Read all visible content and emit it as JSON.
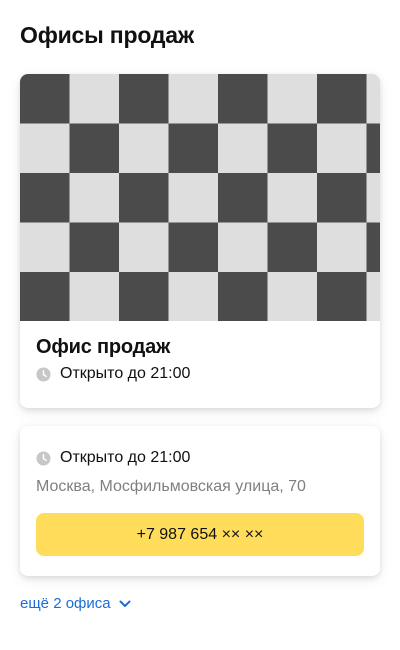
{
  "page": {
    "title": "Офисы продаж"
  },
  "office_card": {
    "image_icon": "checkerboard-placeholder-image",
    "name": "Офис продаж",
    "hours_icon": "clock-icon",
    "hours": "Открыто до 21:00"
  },
  "contact_card": {
    "hours_icon": "clock-icon",
    "hours": "Открыто до 21:00",
    "address": "Москва, Мосфильмовская улица, 70",
    "phone_label": "+7 987 654 ×× ××"
  },
  "more_link": {
    "label": "ещё 2 офиса",
    "icon": "chevron-down-icon"
  },
  "colors": {
    "accent_button": "#ffdc5a",
    "link": "#1a6ed8",
    "secondary_text": "#7f7f7f",
    "icon_gray": "#c7c7c7",
    "checker_dark": "#4b4b4b",
    "checker_light": "#dedede"
  }
}
